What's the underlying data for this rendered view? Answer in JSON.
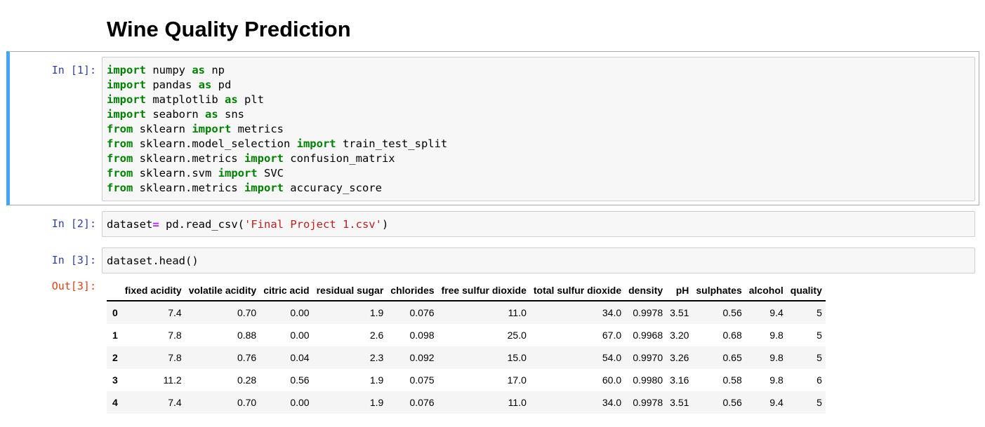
{
  "notebook": {
    "title": "Wine Quality Prediction"
  },
  "cells": [
    {
      "prompt": "In [1]:",
      "lines": [
        [
          [
            "kw",
            "import"
          ],
          [
            "t",
            " numpy "
          ],
          [
            "kw",
            "as"
          ],
          [
            "t",
            " np"
          ]
        ],
        [
          [
            "kw",
            "import"
          ],
          [
            "t",
            " pandas "
          ],
          [
            "kw",
            "as"
          ],
          [
            "t",
            " pd"
          ]
        ],
        [
          [
            "kw",
            "import"
          ],
          [
            "t",
            " matplotlib "
          ],
          [
            "kw",
            "as"
          ],
          [
            "t",
            " plt"
          ]
        ],
        [
          [
            "kw",
            "import"
          ],
          [
            "t",
            " seaborn "
          ],
          [
            "kw",
            "as"
          ],
          [
            "t",
            " sns"
          ]
        ],
        [
          [
            "kw",
            "from"
          ],
          [
            "t",
            " sklearn "
          ],
          [
            "kw",
            "import"
          ],
          [
            "t",
            " metrics"
          ]
        ],
        [
          [
            "kw",
            "from"
          ],
          [
            "t",
            " sklearn.model_selection "
          ],
          [
            "kw",
            "import"
          ],
          [
            "t",
            " train_test_split"
          ]
        ],
        [
          [
            "kw",
            "from"
          ],
          [
            "t",
            " sklearn.metrics "
          ],
          [
            "kw",
            "import"
          ],
          [
            "t",
            " confusion_matrix"
          ]
        ],
        [
          [
            "kw",
            "from"
          ],
          [
            "t",
            " sklearn.svm "
          ],
          [
            "kw",
            "import"
          ],
          [
            "t",
            " SVC"
          ]
        ],
        [
          [
            "kw",
            "from"
          ],
          [
            "t",
            " sklearn.metrics "
          ],
          [
            "kw",
            "import"
          ],
          [
            "t",
            " accuracy_score"
          ]
        ]
      ]
    },
    {
      "prompt": "In [2]:",
      "lines": [
        [
          [
            "t",
            "dataset"
          ],
          [
            "op",
            "="
          ],
          [
            "t",
            " pd.read_csv("
          ],
          [
            "str",
            "'Final Project 1.csv'"
          ],
          [
            "t",
            ")"
          ]
        ]
      ]
    },
    {
      "prompt": "In [3]:",
      "lines": [
        [
          [
            "t",
            "dataset.head()"
          ]
        ]
      ]
    }
  ],
  "output": {
    "prompt": "Out[3]:",
    "table": {
      "columns": [
        "",
        "fixed acidity",
        "volatile acidity",
        "citric acid",
        "residual sugar",
        "chlorides",
        "free sulfur dioxide",
        "total sulfur dioxide",
        "density",
        "pH",
        "sulphates",
        "alcohol",
        "quality"
      ],
      "rows": [
        [
          "0",
          "7.4",
          "0.70",
          "0.00",
          "1.9",
          "0.076",
          "11.0",
          "34.0",
          "0.9978",
          "3.51",
          "0.56",
          "9.4",
          "5"
        ],
        [
          "1",
          "7.8",
          "0.88",
          "0.00",
          "2.6",
          "0.098",
          "25.0",
          "67.0",
          "0.9968",
          "3.20",
          "0.68",
          "9.8",
          "5"
        ],
        [
          "2",
          "7.8",
          "0.76",
          "0.04",
          "2.3",
          "0.092",
          "15.0",
          "54.0",
          "0.9970",
          "3.26",
          "0.65",
          "9.8",
          "5"
        ],
        [
          "3",
          "11.2",
          "0.28",
          "0.56",
          "1.9",
          "0.075",
          "17.0",
          "60.0",
          "0.9980",
          "3.16",
          "0.58",
          "9.8",
          "6"
        ],
        [
          "4",
          "7.4",
          "0.70",
          "0.00",
          "1.9",
          "0.076",
          "11.0",
          "34.0",
          "0.9978",
          "3.51",
          "0.56",
          "9.4",
          "5"
        ]
      ]
    }
  },
  "colors": {
    "selected_cell_border": "#42a5f5",
    "in_prompt": "#303f9f",
    "out_prompt": "#d84315",
    "keyword": "#008000",
    "operator": "#aa22ff",
    "string": "#ba2121"
  }
}
